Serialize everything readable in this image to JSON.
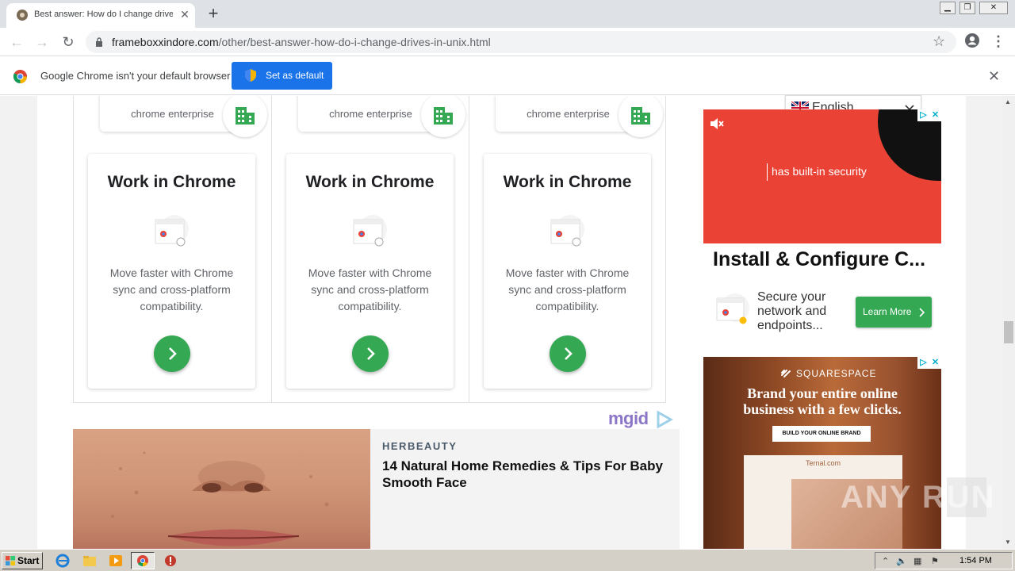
{
  "browser": {
    "tab_title": "Best answer: How do I change drive",
    "url_domain": "frameboxxindore.com",
    "url_path": "/other/best-answer-how-do-i-change-drives-in-unix.html"
  },
  "infobar": {
    "message": "Google Chrome isn't your default browser",
    "button": "Set as default"
  },
  "ad_cards": [
    {
      "enterprise": "chrome enterprise",
      "title": "Work in Chrome",
      "desc": "Move faster with Chrome sync and cross-platform compatibility."
    },
    {
      "enterprise": "chrome enterprise",
      "title": "Work in Chrome",
      "desc": "Move faster with Chrome sync and cross-platform compatibility."
    },
    {
      "enterprise": "chrome enterprise",
      "title": "Work in Chrome",
      "desc": "Move faster with Chrome sync and cross-platform compatibility."
    }
  ],
  "mgid": {
    "logo": "mgid"
  },
  "native_ad": {
    "brand": "HERBEAUTY",
    "title": "14 Natural Home Remedies & Tips For Baby Smooth Face"
  },
  "language": {
    "selected": "English"
  },
  "video_ad": {
    "caption": "has built-in security"
  },
  "sidebar_ad": {
    "title": "Install & Configure C...",
    "text": "Secure your network and endpoints...",
    "button": "Learn More"
  },
  "squarespace_ad": {
    "logo": "SQUARESPACE",
    "headline_1": "Brand your entire online",
    "headline_2": "business with a few clicks.",
    "button": "BUILD YOUR ONLINE BRAND",
    "site_brand": "Ternal.com"
  },
  "watermark": "ANY RUN",
  "taskbar": {
    "start": "Start",
    "clock": "1:54 PM"
  },
  "colors": {
    "accent_blue": "#1a73e8",
    "green": "#34a853",
    "ad_red": "#ea4335"
  }
}
